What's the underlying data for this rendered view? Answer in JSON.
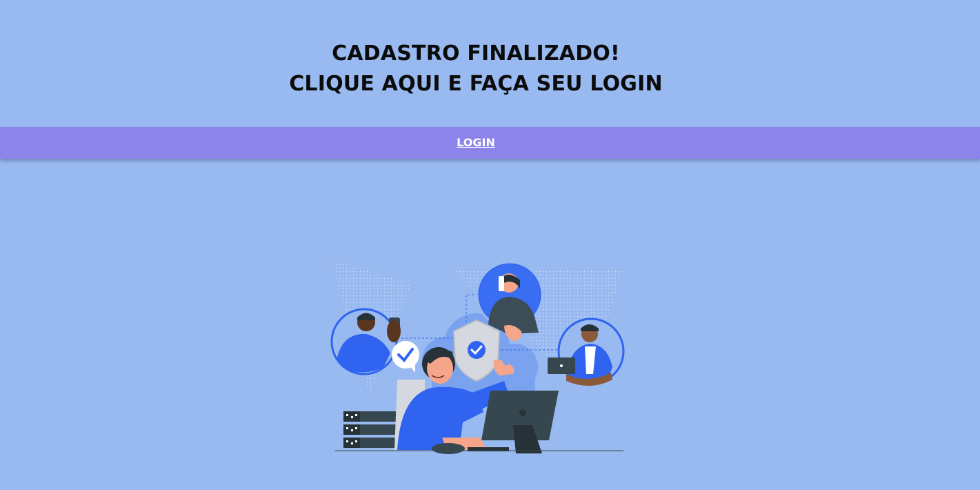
{
  "header": {
    "line1": "CADASTRO FINALIZADO!",
    "line2": "CLIQUE AQUI E FAÇA SEU LOGIN"
  },
  "nav": {
    "login_label": "LOGIN"
  },
  "colors": {
    "background": "#98baf0",
    "login_bar": "#8c84ea",
    "accent_blue": "#2f63f0",
    "dark": "#37474f"
  },
  "illustration": {
    "icon": "security-team-illustration"
  }
}
